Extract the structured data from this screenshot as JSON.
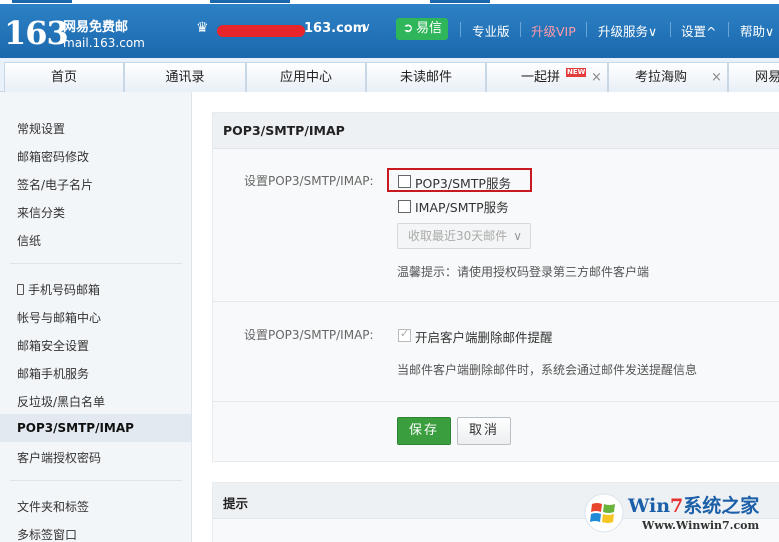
{
  "header": {
    "logo_number": "163",
    "logo_name": "网易免费邮",
    "logo_domain": "mail.163.com",
    "account_suffix": "163.com",
    "yixin_label": "易信",
    "links": {
      "pro": "专业版",
      "vip": "升级VIP",
      "upgrade_services": "升级服务",
      "settings": "设置",
      "help": "帮助"
    },
    "chevron_down": "∨",
    "chevron_up": "^"
  },
  "tabs": [
    {
      "label": "首页"
    },
    {
      "label": "通讯录"
    },
    {
      "label": "应用中心"
    },
    {
      "label": "未读邮件"
    },
    {
      "label": "一起拼",
      "badge": "NEW",
      "close": "×"
    },
    {
      "label": "考拉海购",
      "close": "×"
    },
    {
      "label": "网易"
    }
  ],
  "sidebar": {
    "group1": [
      "常规设置",
      "邮箱密码修改",
      "签名/电子名片",
      "来信分类",
      "信纸"
    ],
    "group2": [
      "手机号码邮箱",
      "帐号与邮箱中心",
      "邮箱安全设置",
      "邮箱手机服务",
      "反垃圾/黑白名单",
      "POP3/SMTP/IMAP",
      "客户端授权密码"
    ],
    "group3": [
      "文件夹和标签",
      "多标签窗口"
    ],
    "active": "POP3/SMTP/IMAP"
  },
  "main": {
    "section_title": "POP3/SMTP/IMAP",
    "row1_label": "设置POP3/SMTP/IMAP:",
    "option_pop3": "POP3/SMTP服务",
    "option_imap": "IMAP/SMTP服务",
    "fetch_select": "收取最近30天邮件",
    "fetch_chevron": "∨",
    "tip": "温馨提示：请使用授权码登录第三方邮件客户端",
    "row2_label": "设置POP3/SMTP/IMAP:",
    "option_delete_alert": "开启客户端删除邮件提醒",
    "delete_alert_desc": "当邮件客户端删除邮件时，系统会通过邮件发送提醒信息",
    "save_label": "保存",
    "cancel_label": "取消",
    "notice_title": "提示"
  },
  "watermark": {
    "brand_a": "Win",
    "brand_seven": "7",
    "brand_b": "系统之家",
    "url": "Www.Winwin7.com"
  },
  "colors": {
    "header_blue": "#1b68ad",
    "yixin_green": "#2fb65a",
    "save_green": "#3a9e3e",
    "highlight_red": "#c81820"
  }
}
